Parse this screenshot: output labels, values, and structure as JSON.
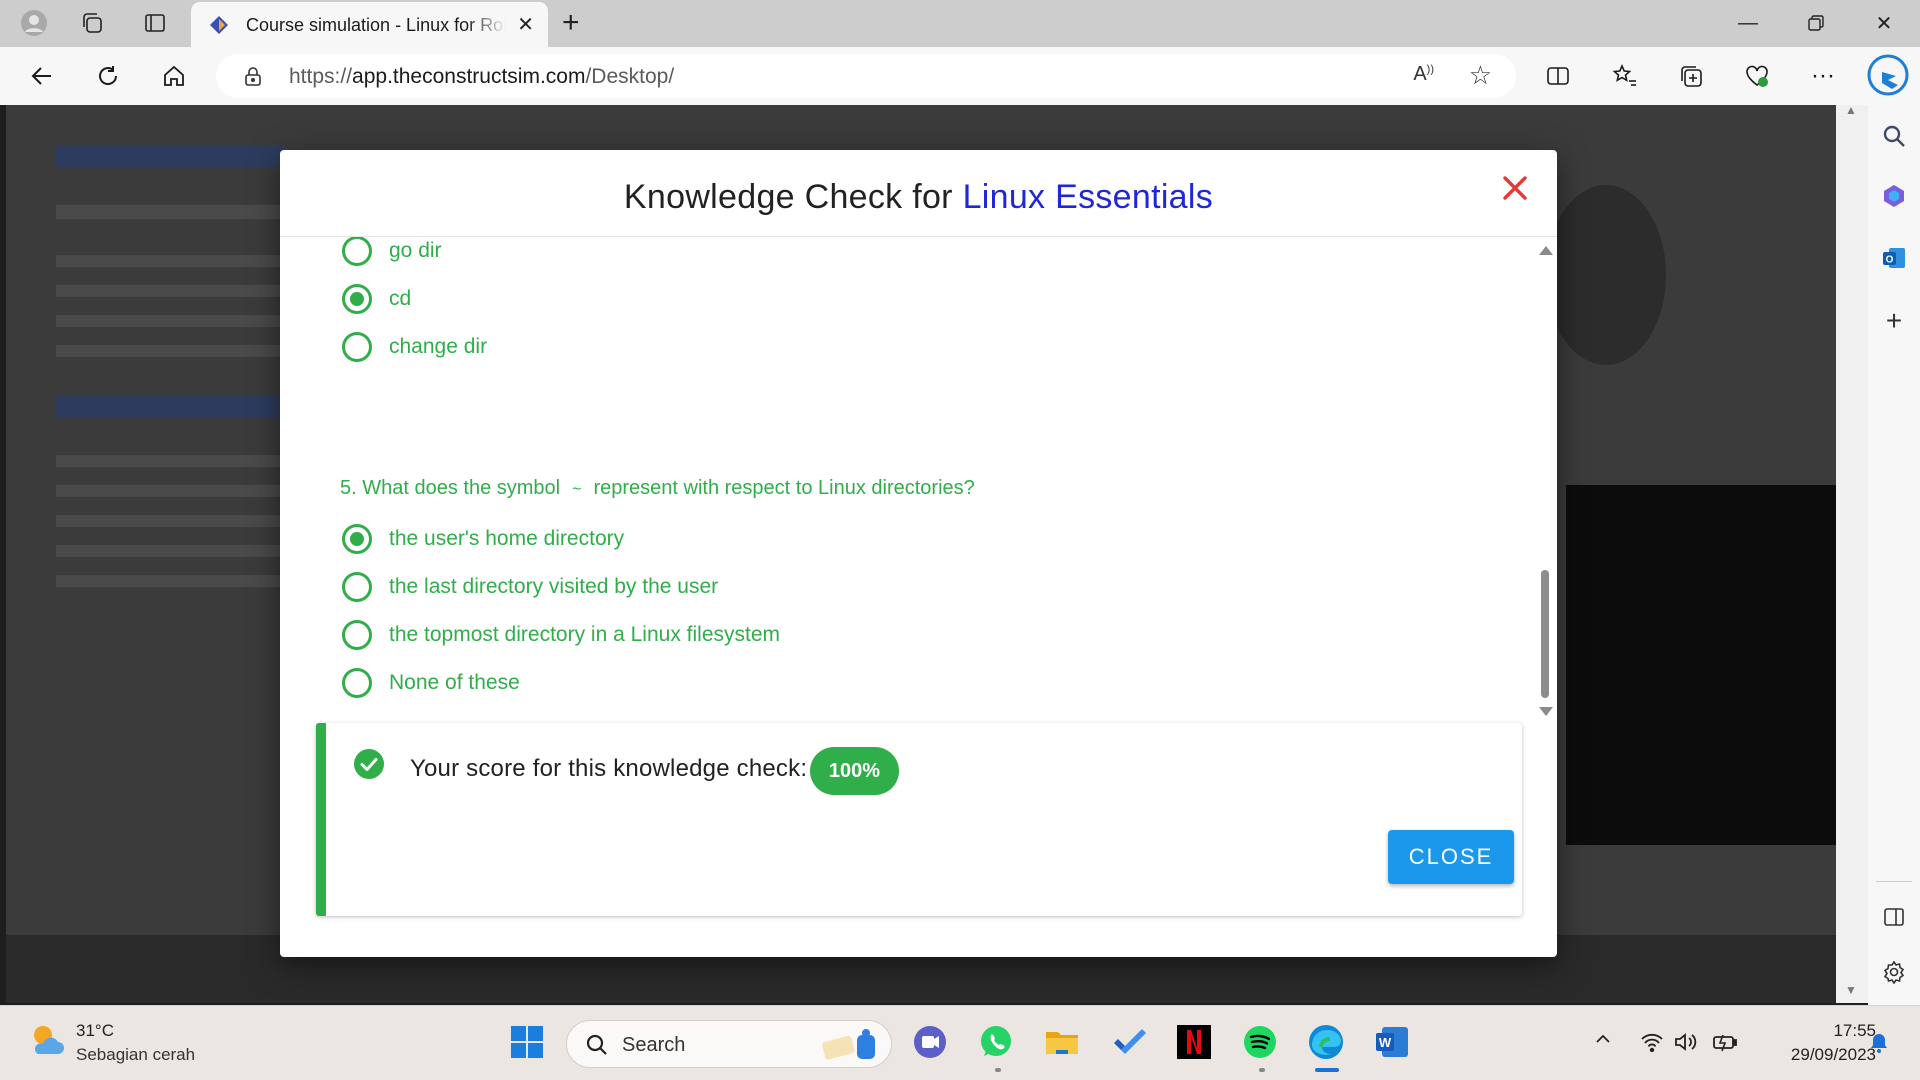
{
  "browser": {
    "tab": {
      "title": "Course simulation - Linux for Robotics"
    },
    "url": {
      "scheme": "https://",
      "host": "app.theconstructsim.com",
      "path": "/Desktop/"
    }
  },
  "modal": {
    "title_prefix": "Knowledge Check for",
    "title_course": "Linux Essentials",
    "question4_options": [
      {
        "label": "go dir",
        "selected": false
      },
      {
        "label": "cd",
        "selected": true
      },
      {
        "label": "change dir",
        "selected": false
      }
    ],
    "question5": {
      "text_before": "5. What does the symbol",
      "symbol": "~",
      "text_after": "represent with respect to Linux directories?",
      "options": [
        {
          "label": "the user's home directory",
          "selected": true
        },
        {
          "label": "the last directory visited by the user",
          "selected": false
        },
        {
          "label": "the topmost directory in a Linux filesystem",
          "selected": false
        },
        {
          "label": "None of these",
          "selected": false
        }
      ]
    },
    "score": {
      "label": "Your score for this knowledge check:",
      "value": "100%"
    },
    "close_label": "CLOSE"
  },
  "taskbar": {
    "weather": {
      "temp": "31°C",
      "desc": "Sebagian cerah"
    },
    "search_label": "Search",
    "time": "17:55",
    "date": "29/09/2023"
  },
  "colors": {
    "accent_green": "#2fae4a",
    "title_blue": "#1f27d6",
    "button_blue": "#1b97ec",
    "close_red": "#e53935"
  },
  "icons": [
    "profile-icon",
    "workspaces-icon",
    "tab-actions-icon",
    "tab-favicon",
    "tab-close-icon",
    "new-tab-icon",
    "minimize-icon",
    "restore-icon",
    "window-close-icon",
    "back-icon",
    "refresh-icon",
    "home-icon",
    "lock-icon",
    "read-aloud-icon",
    "favorite-star-icon",
    "split-screen-icon",
    "favorites-icon",
    "collections-icon",
    "browser-essentials-icon",
    "more-icon",
    "copilot-icon",
    "sidebar-search-icon",
    "sidebar-shopping-icon",
    "outlook-icon",
    "add-icon",
    "sidebar-layout-icon",
    "settings-icon",
    "modal-close-icon",
    "check-circle-icon",
    "weather-icon",
    "windows-start-icon",
    "search-icon",
    "teams-icon",
    "whatsapp-icon",
    "file-explorer-icon",
    "todo-icon",
    "netflix-icon",
    "spotify-icon",
    "edge-icon",
    "word-icon",
    "chevron-up-icon",
    "wifi-icon",
    "volume-icon",
    "battery-icon",
    "notification-bell-icon"
  ]
}
